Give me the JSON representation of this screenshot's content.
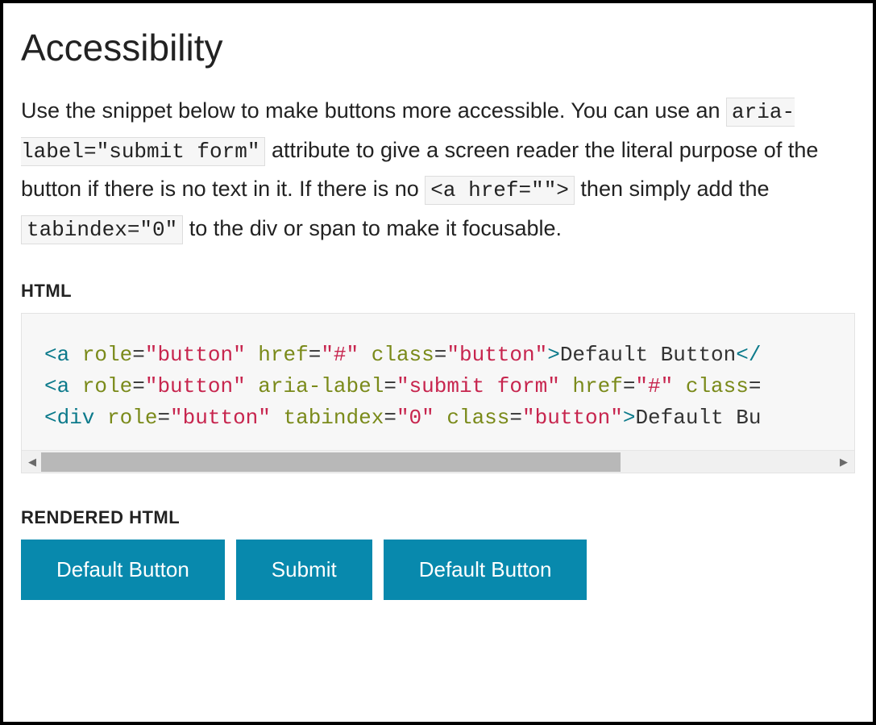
{
  "title": "Accessibility",
  "paragraph": {
    "p1": "Use the snippet below to make buttons more accessible. You can use an ",
    "code1": "aria-label=\"submit form\"",
    "p2": " attribute to give a screen reader the literal purpose of the button if there is no text in it. If there is no ",
    "code2": "<a href=\"\">",
    "p3": " then simply add the ",
    "code3": "tabindex=\"0\"",
    "p4": " to the div or span to make it focusable."
  },
  "labels": {
    "html": "HTML",
    "rendered": "RENDERED HTML"
  },
  "code": {
    "lines": [
      {
        "tag_open": "<a",
        "attrs": [
          {
            "name": " role",
            "eq": "=",
            "q1": "\"",
            "val": "button",
            "q2": "\""
          },
          {
            "name": " href",
            "eq": "=",
            "q1": "\"",
            "val": "#",
            "q2": "\""
          },
          {
            "name": " class",
            "eq": "=",
            "q1": "\"",
            "val": "button",
            "q2": "\""
          }
        ],
        "gt": ">",
        "text": "Default Button",
        "close": "</",
        "tail": ""
      },
      {
        "tag_open": "<a",
        "attrs": [
          {
            "name": " role",
            "eq": "=",
            "q1": "\"",
            "val": "button",
            "q2": "\""
          },
          {
            "name": " aria-label",
            "eq": "=",
            "q1": "\"",
            "val": "submit form",
            "q2": "\""
          },
          {
            "name": " href",
            "eq": "=",
            "q1": "\"",
            "val": "#",
            "q2": "\""
          },
          {
            "name": " class",
            "eq": "=",
            "q1": "",
            "val": "",
            "q2": ""
          }
        ],
        "gt": "",
        "text": "",
        "close": "",
        "tail": ""
      },
      {
        "tag_open": "<div",
        "attrs": [
          {
            "name": " role",
            "eq": "=",
            "q1": "\"",
            "val": "button",
            "q2": "\""
          },
          {
            "name": " tabindex",
            "eq": "=",
            "q1": "\"",
            "val": "0",
            "q2": "\""
          },
          {
            "name": " class",
            "eq": "=",
            "q1": "\"",
            "val": "button",
            "q2": "\""
          }
        ],
        "gt": ">",
        "text": "Default Bu",
        "close": "",
        "tail": ""
      }
    ]
  },
  "buttons": [
    {
      "label": "Default Button"
    },
    {
      "label": "Submit"
    },
    {
      "label": "Default Button"
    }
  ]
}
